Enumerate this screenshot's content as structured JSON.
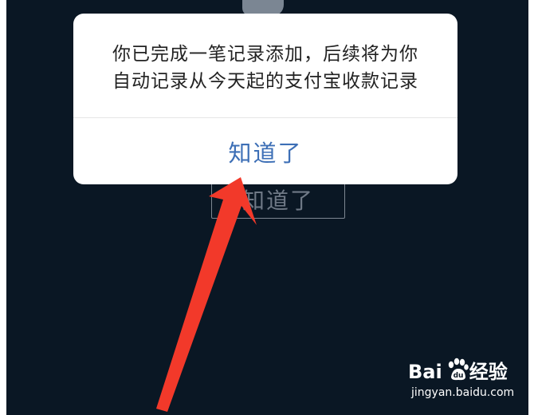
{
  "dialog": {
    "message_line1": "你已完成一笔记录添加，后续将为你",
    "message_line2": "自动记录从今天起的支付宝收款记录",
    "confirm_label": "知道了"
  },
  "background": {
    "button_label": "知道了"
  },
  "watermark": {
    "logo_text_left": "Bai",
    "logo_text_right": "经验",
    "url": "jingyan.baidu.com"
  },
  "colors": {
    "screen_background": "#0a1724",
    "dialog_background": "#ffffff",
    "confirm_text": "#3d6fb6",
    "annotation_arrow": "#f2392a"
  }
}
